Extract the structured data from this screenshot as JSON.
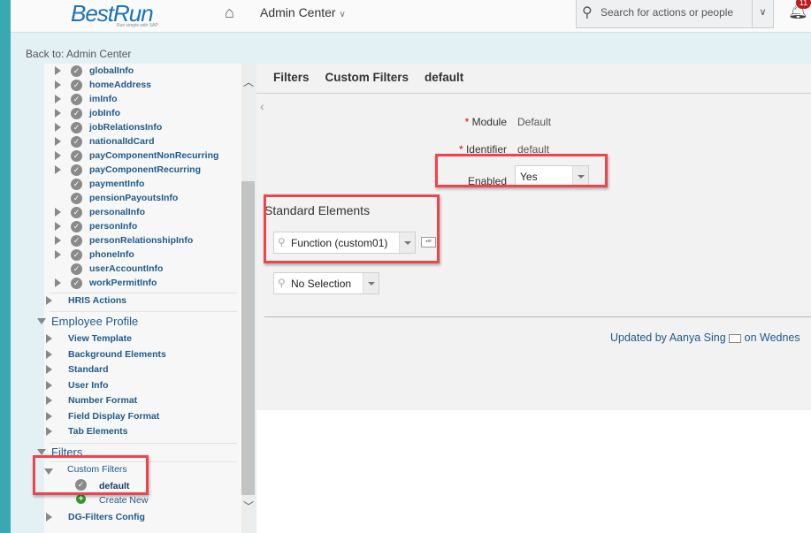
{
  "header": {
    "logo": "BestRun",
    "logo_tagline": "Run simple with SAP",
    "module": "Admin Center",
    "search_placeholder": "Search for actions or people",
    "notification_count": "11"
  },
  "back_link": "Back to: Admin Center",
  "sidebar": {
    "hris_elements": [
      {
        "label": "globalInfo",
        "expandable": true
      },
      {
        "label": "homeAddress",
        "expandable": true
      },
      {
        "label": "imInfo",
        "expandable": true
      },
      {
        "label": "jobInfo",
        "expandable": true
      },
      {
        "label": "jobRelationsInfo",
        "expandable": true
      },
      {
        "label": "nationalIdCard",
        "expandable": true
      },
      {
        "label": "payComponentNonRecurring",
        "expandable": true
      },
      {
        "label": "payComponentRecurring",
        "expandable": true
      },
      {
        "label": "paymentInfo",
        "expandable": false
      },
      {
        "label": "pensionPayoutsInfo",
        "expandable": false
      },
      {
        "label": "personalInfo",
        "expandable": true
      },
      {
        "label": "personInfo",
        "expandable": true
      },
      {
        "label": "personRelationshipInfo",
        "expandable": true
      },
      {
        "label": "phoneInfo",
        "expandable": true
      },
      {
        "label": "userAccountInfo",
        "expandable": false
      },
      {
        "label": "workPermitInfo",
        "expandable": true
      }
    ],
    "hris_actions": "HRIS Actions",
    "employee_profile": {
      "label": "Employee Profile",
      "items": [
        "View Template",
        "Background Elements",
        "Standard",
        "User Info",
        "Number Format",
        "Field Display Format",
        "Tab Elements"
      ]
    },
    "filters": {
      "label": "Filters",
      "custom_filters": "Custom Filters",
      "default": "default",
      "create_new": "Create New",
      "dg_filters": "DG-Filters Config"
    }
  },
  "main": {
    "breadcrumb": [
      "Filters",
      "Custom Filters",
      "default"
    ],
    "module_label": "Module",
    "module_value": "Default",
    "identifier_label": "Identifier",
    "identifier_value": "default",
    "enabled_label": "Enabled",
    "enabled_value": "Yes",
    "standard_elements": "Standard Elements",
    "element_1": "Function (custom01)",
    "element_2": "No Selection",
    "updated_by": "Updated by Aanya Sing",
    "updated_on": "on Wednes"
  },
  "colors": {
    "accent": "#1f5a8c",
    "highlight": "#f0444a",
    "teal": "#3aa8b0"
  }
}
